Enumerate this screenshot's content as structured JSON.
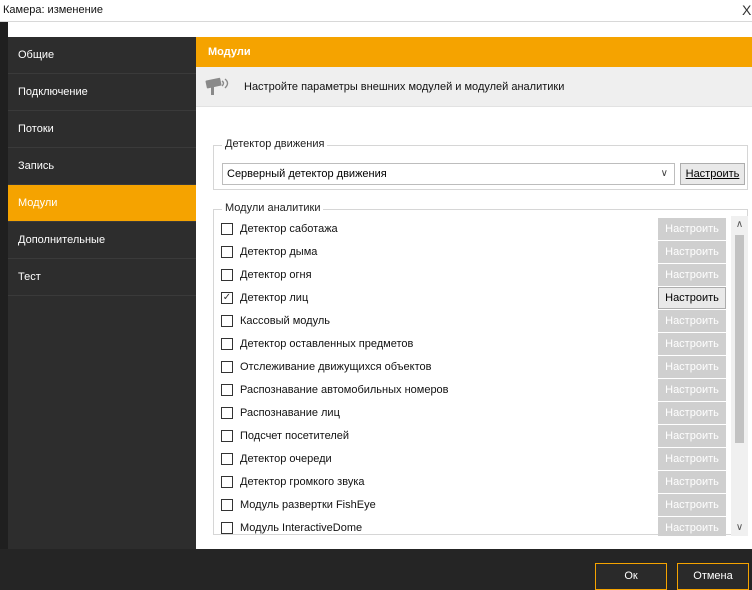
{
  "window": {
    "title": "Камера: изменение",
    "close_glyph": "X"
  },
  "sidebar": {
    "items": [
      {
        "label": "Общие",
        "active": false
      },
      {
        "label": "Подключение",
        "active": false
      },
      {
        "label": "Потоки",
        "active": false
      },
      {
        "label": "Запись",
        "active": false
      },
      {
        "label": "Модули",
        "active": true
      },
      {
        "label": "Дополнительные",
        "active": false
      },
      {
        "label": "Тест",
        "active": false
      }
    ]
  },
  "section": {
    "title": "Модули",
    "description": "Настройте параметры внешних модулей и модулей аналитики",
    "icon": "camera-icon"
  },
  "motion_detector": {
    "group_label": "Детектор движения",
    "selected": "Серверный детектор движения",
    "configure_label": "Настроить"
  },
  "analytics": {
    "group_label": "Модули аналитики",
    "configure_label": "Настроить",
    "modules": [
      {
        "label": "Детектор саботажа",
        "checked": false
      },
      {
        "label": "Детектор дыма",
        "checked": false
      },
      {
        "label": "Детектор огня",
        "checked": false
      },
      {
        "label": "Детектор лиц",
        "checked": true
      },
      {
        "label": "Кассовый модуль",
        "checked": false
      },
      {
        "label": "Детектор оставленных предметов",
        "checked": false
      },
      {
        "label": "Отслеживание движущихся объектов",
        "checked": false
      },
      {
        "label": "Распознавание автомобильных номеров",
        "checked": false
      },
      {
        "label": "Распознавание лиц",
        "checked": false
      },
      {
        "label": "Подсчет посетителей",
        "checked": false
      },
      {
        "label": "Детектор очереди",
        "checked": false
      },
      {
        "label": "Детектор громкого звука",
        "checked": false
      },
      {
        "label": "Модуль развертки FishEye",
        "checked": false
      },
      {
        "label": "Модуль InteractiveDome",
        "checked": false
      }
    ]
  },
  "footer": {
    "ok_label": "Ок",
    "cancel_label": "Отмена"
  },
  "colors": {
    "accent": "#f5a300",
    "sidebar_bg": "#2d2d2d",
    "footer_bg": "#252525"
  }
}
